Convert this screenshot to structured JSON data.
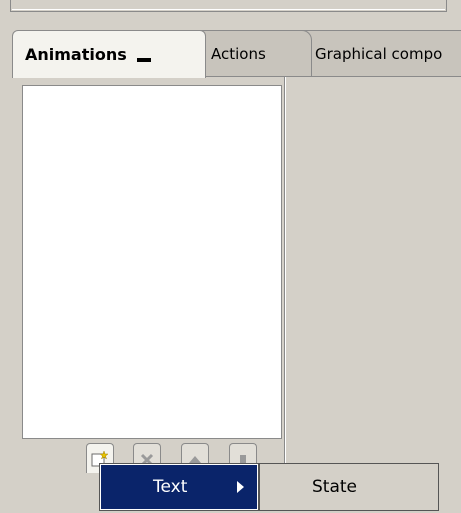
{
  "tabs": [
    {
      "label": "Animations",
      "active": true
    },
    {
      "label": "Actions",
      "active": false
    },
    {
      "label": "Graphical compo",
      "active": false
    }
  ],
  "list": {
    "items": []
  },
  "toolbar": {
    "buttons": [
      {
        "name": "new-animation-button",
        "icon": "new-item-icon"
      },
      {
        "name": "delete-animation-button",
        "icon": "delete-icon"
      },
      {
        "name": "move-up-button",
        "icon": "up-arrow-icon"
      },
      {
        "name": "move-down-button",
        "icon": "down-arrow-icon"
      }
    ]
  },
  "context_menu": {
    "items": [
      {
        "label": "Text",
        "has_submenu": true
      }
    ],
    "submenu": {
      "items": [
        {
          "label": "State"
        }
      ]
    }
  },
  "colors": {
    "background": "#d4d0c8",
    "menu_highlight": "#0a246a",
    "menu_highlight_text": "#ffffff"
  }
}
